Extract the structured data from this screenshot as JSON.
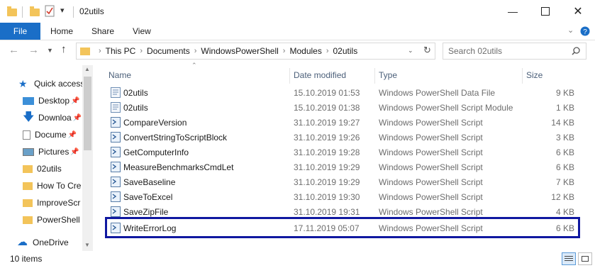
{
  "window": {
    "title": "02utils",
    "controls": [
      "minimize-icon",
      "maximize-icon",
      "close-icon"
    ]
  },
  "ribbon": {
    "file_label": "File",
    "tabs": [
      "Home",
      "Share",
      "View"
    ]
  },
  "address": {
    "crumbs": [
      "This PC",
      "Documents",
      "WindowsPowerShell",
      "Modules",
      "02utils"
    ],
    "search_placeholder": "Search 02utils"
  },
  "nav": {
    "items": [
      {
        "label": "Quick access",
        "icon": "star-icon",
        "pinned": false
      },
      {
        "label": "Desktop",
        "icon": "desktop-icon",
        "pinned": true
      },
      {
        "label": "Downloa",
        "icon": "download-icon",
        "pinned": true
      },
      {
        "label": "Docume",
        "icon": "documents-icon",
        "pinned": true
      },
      {
        "label": "Pictures",
        "icon": "pictures-icon",
        "pinned": true
      },
      {
        "label": "02utils",
        "icon": "folder-icon",
        "pinned": false
      },
      {
        "label": "How To Cre",
        "icon": "folder-icon",
        "pinned": false
      },
      {
        "label": "ImproveScr",
        "icon": "folder-icon",
        "pinned": false
      },
      {
        "label": "PowerShell",
        "icon": "folder-icon",
        "pinned": false
      },
      {
        "label": "OneDrive",
        "icon": "cloud-icon",
        "pinned": false
      }
    ]
  },
  "columns": {
    "name": "Name",
    "date": "Date modified",
    "type": "Type",
    "size": "Size"
  },
  "files": [
    {
      "name": "02utils",
      "date": "15.10.2019 01:53",
      "type": "Windows PowerShell Data File",
      "size": "9 KB",
      "icon": "psd1-icon"
    },
    {
      "name": "02utils",
      "date": "15.10.2019 01:38",
      "type": "Windows PowerShell Script Module",
      "size": "1 KB",
      "icon": "psm1-icon"
    },
    {
      "name": "CompareVersion",
      "date": "31.10.2019 19:27",
      "type": "Windows PowerShell Script",
      "size": "14 KB",
      "icon": "ps1-icon"
    },
    {
      "name": "ConvertStringToScriptBlock",
      "date": "31.10.2019 19:26",
      "type": "Windows PowerShell Script",
      "size": "3 KB",
      "icon": "ps1-icon"
    },
    {
      "name": "GetComputerInfo",
      "date": "31.10.2019 19:28",
      "type": "Windows PowerShell Script",
      "size": "6 KB",
      "icon": "ps1-icon"
    },
    {
      "name": "MeasureBenchmarksCmdLet",
      "date": "31.10.2019 19:29",
      "type": "Windows PowerShell Script",
      "size": "6 KB",
      "icon": "ps1-icon"
    },
    {
      "name": "SaveBaseline",
      "date": "31.10.2019 19:29",
      "type": "Windows PowerShell Script",
      "size": "7 KB",
      "icon": "ps1-icon"
    },
    {
      "name": "SaveToExcel",
      "date": "31.10.2019 19:30",
      "type": "Windows PowerShell Script",
      "size": "12 KB",
      "icon": "ps1-icon"
    },
    {
      "name": "SaveZipFile",
      "date": "31.10.2019 19:31",
      "type": "Windows PowerShell Script",
      "size": "4 KB",
      "icon": "ps1-icon"
    },
    {
      "name": "WriteErrorLog",
      "date": "17.11.2019 05:07",
      "type": "Windows PowerShell Script",
      "size": "6 KB",
      "icon": "ps1-icon",
      "highlighted": true
    }
  ],
  "status": {
    "item_count": "10 items"
  },
  "colors": {
    "file_tab": "#1a6ec7",
    "highlight_border": "#1018a0",
    "folder": "#f3c45a"
  }
}
